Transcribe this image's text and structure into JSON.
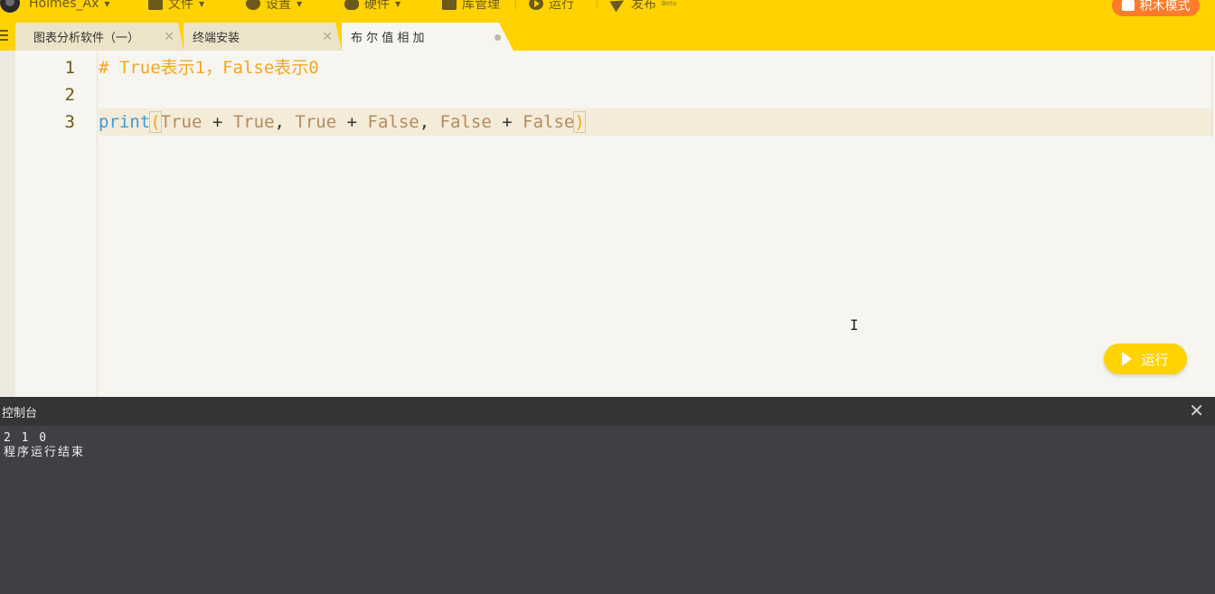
{
  "menubar": {
    "user": "Holmes_Ax",
    "file": "文件",
    "settings": "设置",
    "hardware": "硬件",
    "library": "库管理",
    "run": "运行",
    "publish": "发布",
    "publish_badge": "Beta",
    "block_mode": "积木模式"
  },
  "tabs": [
    {
      "label": "图表分析软件（一）",
      "close": "✕"
    },
    {
      "label": "终端安装",
      "close": "✕"
    },
    {
      "label": "布 尔 值 相 加"
    }
  ],
  "editor": {
    "line_numbers": [
      "1",
      "2",
      "3"
    ],
    "line1": "# True表示1，False表示0",
    "line3": {
      "func": "print",
      "open": "(",
      "t1": "True",
      "plus1": " + ",
      "t2": "True",
      "comma1": ", ",
      "t3": "True",
      "plus2": " + ",
      "t4": "False",
      "comma2": ", ",
      "t5": "False",
      "plus3": " + ",
      "t6": "False",
      "close": ")"
    },
    "run_button": "运行"
  },
  "console": {
    "title": "控制台",
    "close": "✕",
    "lines": [
      "2 1 0",
      "程序运行结束"
    ]
  },
  "colors": {
    "accent": "#ffd200",
    "block_mode": "#ff7a29",
    "comment": "#f5a623",
    "keyword_func": "#3b9ad9",
    "constant": "#b58a5f",
    "console_bg": "#404044"
  }
}
